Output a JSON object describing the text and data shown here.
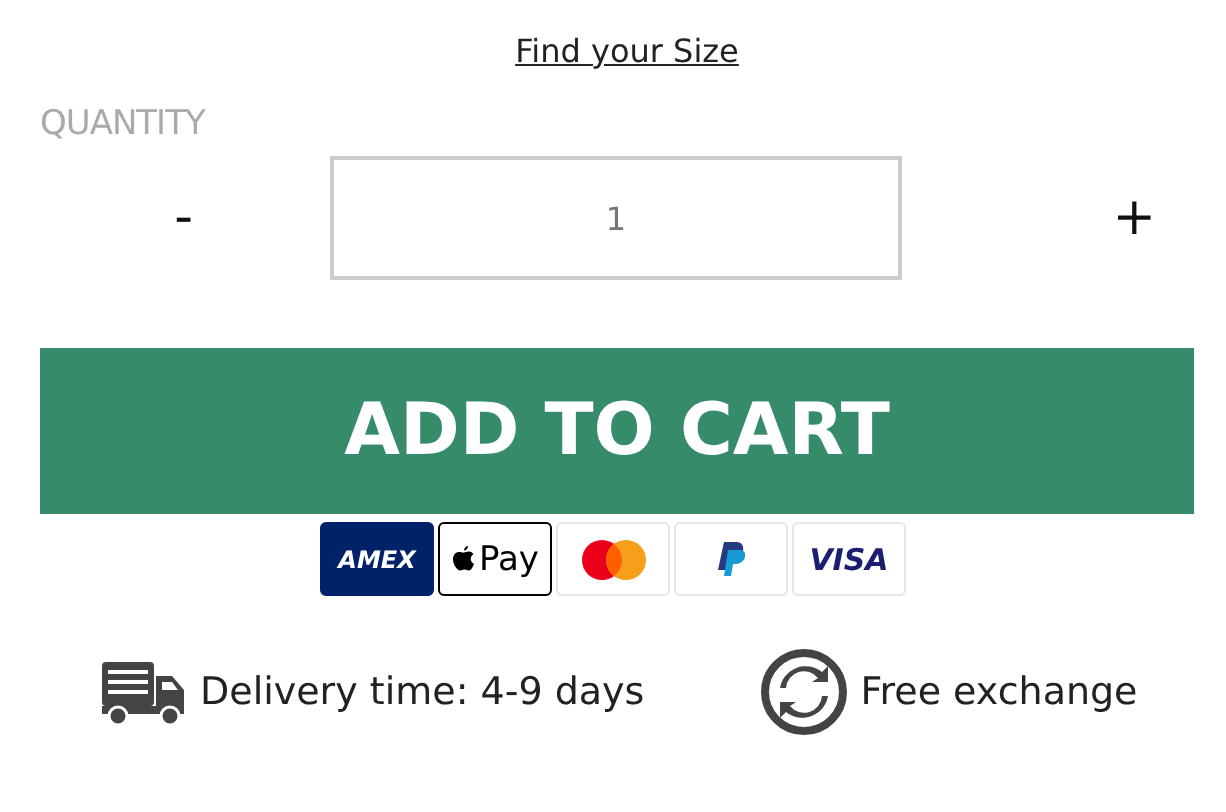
{
  "size_link": "Find your Size",
  "quantity": {
    "label": "QUANTITY",
    "minus": "-",
    "value": "1",
    "plus": "+"
  },
  "add_to_cart": "ADD TO CART",
  "payment_methods": [
    {
      "kind": "amex",
      "text": "AMEX"
    },
    {
      "kind": "applepay",
      "text": "Pay"
    },
    {
      "kind": "mastercard"
    },
    {
      "kind": "paypal"
    },
    {
      "kind": "visa",
      "text": "VISA"
    }
  ],
  "features": [
    {
      "kind": "delivery",
      "text": "Delivery time: 4-9 days"
    },
    {
      "kind": "exchange",
      "text": "Free exchange"
    }
  ]
}
